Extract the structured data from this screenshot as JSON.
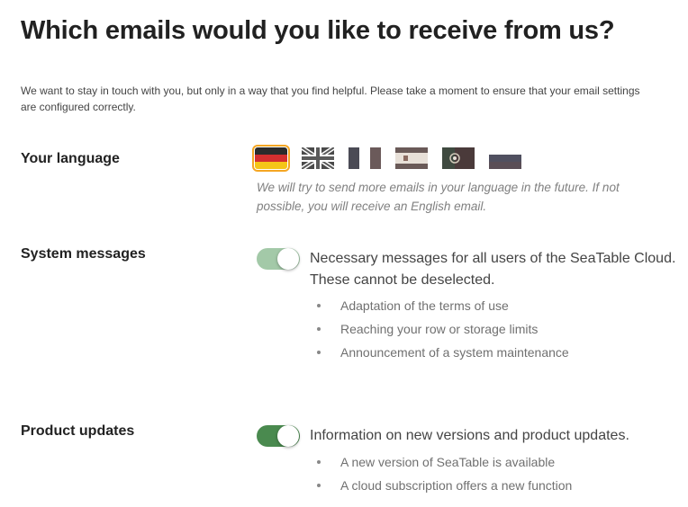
{
  "page": {
    "title": "Which emails would you like to receive from us?",
    "intro": "We want to stay in touch with you, but only in a way that you find helpful. Please take a moment to ensure that your email settings are configured correctly."
  },
  "language": {
    "label": "Your language",
    "flags": [
      {
        "name": "german-flag",
        "selected": true
      },
      {
        "name": "uk-flag",
        "selected": false
      },
      {
        "name": "french-flag",
        "selected": false
      },
      {
        "name": "spanish-flag",
        "selected": false
      },
      {
        "name": "portuguese-flag",
        "selected": false
      },
      {
        "name": "russian-flag",
        "selected": false
      }
    ],
    "note": "We will try to send more emails in your language in the future. If not possible, you will receive an English email."
  },
  "system_messages": {
    "label": "System messages",
    "toggle_state": "on-disabled",
    "description": "Necessary messages for all users of the SeaTable Cloud. These cannot be deselected.",
    "bullets": [
      "Adaptation of the terms of use",
      "Reaching your row or storage limits",
      "Announcement of a system maintenance"
    ]
  },
  "product_updates": {
    "label": "Product updates",
    "toggle_state": "on",
    "description": "Information on new versions and product updates.",
    "bullets": [
      "A new version of SeaTable is available",
      "A cloud subscription offers a new function"
    ]
  },
  "colors": {
    "toggle_disabled": "#a3c9a8",
    "toggle_on": "#4a8a4f",
    "selected_outline": "#f5a623"
  }
}
